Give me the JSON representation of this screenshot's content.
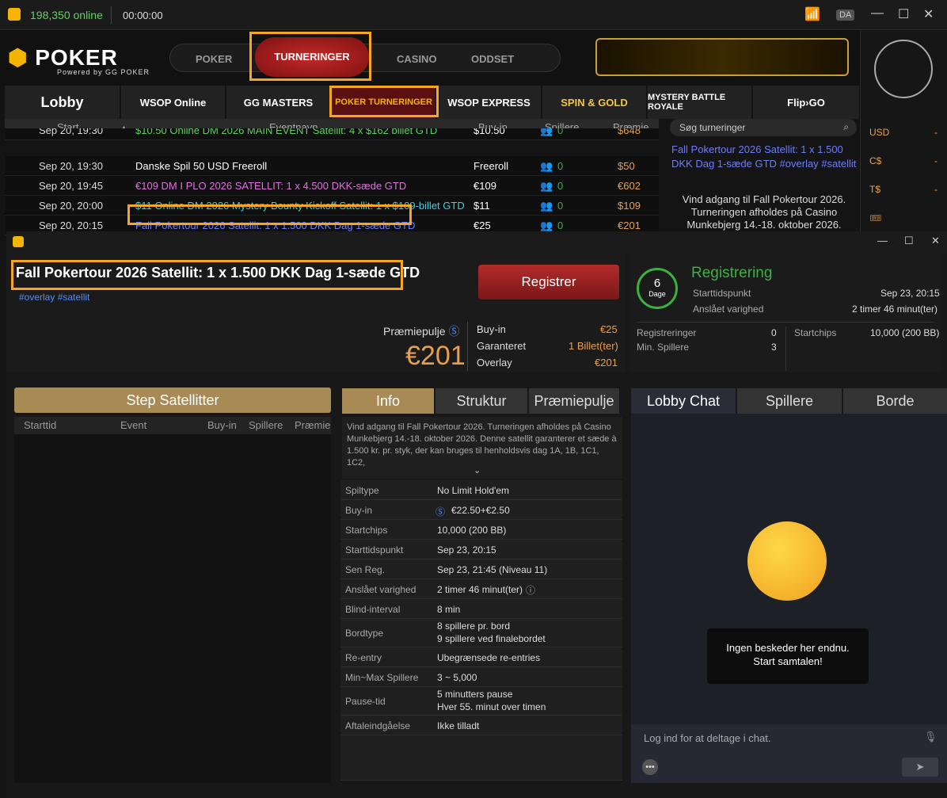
{
  "app": {
    "online": "198,350 online",
    "timer": "00:00:00",
    "lang": "DA"
  },
  "brand": {
    "name": "POKER",
    "powered": "Powered by GG POKER"
  },
  "nav": {
    "items": [
      "POKER",
      "TURNERINGER",
      "CASINO",
      "ODDSET"
    ]
  },
  "subtabs": [
    "Lobby",
    "WSOP Online",
    "GG MASTERS",
    "POKER TURNERINGER",
    "WSOP EXPRESS",
    "SPIN & GOLD",
    "MYSTERY BATTLE ROYALE",
    "Flip›GO"
  ],
  "currency": [
    {
      "name": "USD",
      "value": "-"
    },
    {
      "name": "C$",
      "value": "-"
    },
    {
      "name": "T$",
      "value": "-"
    }
  ],
  "table": {
    "headers": {
      "start": "Start",
      "event": "Eventnavn",
      "buyin": "Buy-in",
      "players": "Spillere",
      "prize": "Præmie"
    },
    "rows": [
      {
        "start": "Sep 20, 19:30",
        "event": "$10.50 Online DM 2026 MAIN EVENT Satellit: 4 x $162 billet GTD",
        "buyin": "$10.50",
        "players": "0",
        "prize": "$648",
        "color": "#5fd35f"
      },
      {
        "start": "Sep 20, 19:30",
        "event": "Danske Spil 50 USD Freeroll",
        "buyin": "Freeroll",
        "players": "0",
        "prize": "$50",
        "color": "#ffffff"
      },
      {
        "start": "Sep 20, 19:45",
        "event": "€109 DM I PLO 2026 SATELLIT: 1 x 4.500 DKK-sæde GTD",
        "buyin": "€109",
        "players": "0",
        "prize": "€602",
        "color": "#e070e0"
      },
      {
        "start": "Sep 20, 20:00",
        "event": "$11 Online DM 2026 Mystery Bounty Kickoff Satellit: 1 x $109-billet GTD",
        "buyin": "$11",
        "players": "0",
        "prize": "$109",
        "color": "#40d0e0"
      },
      {
        "start": "Sep 20, 20:15",
        "event": "Fall Pokertour 2026 Satellit: 1 x 1.500 DKK Dag 1-sæde GTD",
        "buyin": "€25",
        "players": "0",
        "prize": "€201",
        "color": "#6b7cff"
      }
    ]
  },
  "search": {
    "placeholder": "Søg turneringer"
  },
  "side": {
    "title": "Fall Pokertour 2026 Satellit: 1 x 1.500 DKK Dag 1-sæde GTD #overlay #satellit",
    "desc": "Vind adgang til Fall Pokertour 2026. Turneringen afholdes på Casino Munkebjerg 14.-18. oktober 2026."
  },
  "event": {
    "title": "Fall Pokertour 2026 Satellit: 1 x 1.500 DKK Dag 1-sæde GTD",
    "tags": "#overlay #satellit",
    "register": "Registrer",
    "prizepool_label": "Præmiepulje",
    "prizepool": "€201",
    "buyin_label": "Buy-in",
    "buyin": "€25",
    "guaranteed_label": "Garanteret",
    "guaranteed": "1 Billet(ter)",
    "overlay_label": "Overlay",
    "overlay": "€201"
  },
  "status": {
    "days": "6",
    "days_label": "Dage",
    "state": "Registrering",
    "start_label": "Starttidspunkt",
    "start": "Sep 23, 20:15",
    "dur_label": "Anslået varighed",
    "dur": "2 timer 46 minut(ter)",
    "reg_label": "Registreringer",
    "reg": "0",
    "min_label": "Min. Spillere",
    "min": "3",
    "chips_label": "Startchips",
    "chips": "10,000 (200 BB)"
  },
  "steps": {
    "title": "Step Satellitter",
    "cols": [
      "Starttid",
      "Event",
      "Buy-in",
      "Spillere",
      "Præmie"
    ]
  },
  "info": {
    "tabs": [
      "Info",
      "Struktur",
      "Præmiepulje"
    ],
    "intro": "Vind adgang til Fall Pokertour 2026. Turneringen afholdes på Casino Munkebjerg 14.-18. oktober 2026. Denne satellit garanterer et sæde à 1.500 kr. pr. styk, der kan bruges til henholdsvis dag 1A, 1B, 1C1, 1C2,",
    "rows": [
      {
        "k": "Spiltype",
        "v": "No Limit Hold'em"
      },
      {
        "k": "Buy-in",
        "v": "€22.50+€2.50"
      },
      {
        "k": "Startchips",
        "v": "10,000 (200 BB)"
      },
      {
        "k": "Starttidspunkt",
        "v": "Sep 23, 20:15"
      },
      {
        "k": "Sen Reg.",
        "v": "Sep 23, 21:45 (Niveau 11)"
      },
      {
        "k": "Anslået varighed",
        "v": "2 timer 46 minut(ter)"
      },
      {
        "k": "Blind-interval",
        "v": "8 min"
      },
      {
        "k": "Bordtype",
        "v": "8 spillere pr. bord",
        "v2": "9 spillere ved finalebordet"
      },
      {
        "k": "Re-entry",
        "v": "Ubegrænsede re-entries"
      },
      {
        "k": "Min~Max Spillere",
        "v": "3 ~ 5,000"
      },
      {
        "k": "Pause-tid",
        "v": "5 minutters pause",
        "v2": "Hver 55. minut over timen"
      },
      {
        "k": "Aftaleindgåelse",
        "v": "Ikke tilladt"
      }
    ]
  },
  "chat": {
    "tabs": [
      "Lobby Chat",
      "Spillere",
      "Borde"
    ],
    "empty": "Ingen beskeder her endnu. Start samtalen!",
    "placeholder": "Log ind for at deltage i chat."
  }
}
